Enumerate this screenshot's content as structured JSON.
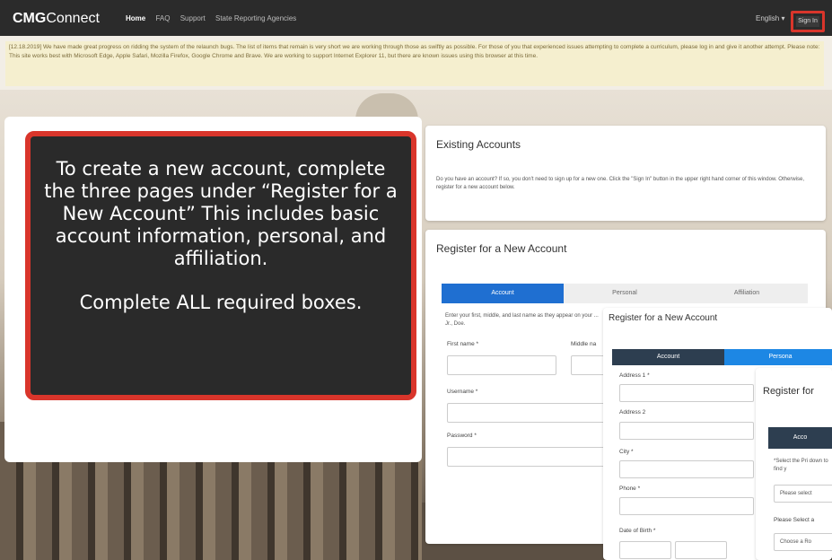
{
  "header": {
    "brand_bold": "CMG",
    "brand_rest": "Connect",
    "nav": [
      "Home",
      "FAQ",
      "Support",
      "State Reporting Agencies"
    ],
    "language": "English ▾",
    "signin_label": "Sign In"
  },
  "notice": {
    "text": "[12.18.2019] We have made great progress on ridding the system of the relaunch bugs. The list of items that remain is very short we are working through those as swiftly as possible. For those of you that experienced issues attempting to complete a curriculum, please log in and give it another attempt. Please note: This site works best with Microsoft Edge, Apple Safari, Mozilla Firefox, Google Chrome and Brave. We are working to support Internet Explorer 11, but there are known issues using this browser at this time."
  },
  "callout": {
    "main": "To create a new account, complete the three pages under “Register for a New Account” This includes basic account information, personal, and affiliation.",
    "sub": "Complete ALL required boxes."
  },
  "existing": {
    "title": "Existing Accounts",
    "text": "Do you have an account? If so, you don't need to sign up for a new one. Click the \"Sign In\" button in the upper right hand corner of this window. Otherwise, register for a new account below."
  },
  "register": {
    "title": "Register for a New Account",
    "tabs": [
      "Account",
      "Personal",
      "Affiliation"
    ],
    "instruction": "Enter your first, middle, and last name as they appear on your ... Jr., Doe.",
    "first_name_label": "First name *",
    "middle_name_label": "Middle na",
    "username_label": "Username *",
    "password_label": "Password *"
  },
  "register2": {
    "title": "Register for a New Account",
    "tabs": [
      "Account",
      "Persona"
    ],
    "address1_label": "Address 1 *",
    "address2_label": "Address 2",
    "city_label": "City *",
    "phone_label": "Phone *",
    "dob_label": "Date of Birth *"
  },
  "register3": {
    "title": "Register for",
    "tab": "Acco",
    "select_text": "*Select the Pri down to find y",
    "select_placeholder": "Please select",
    "select2_label": "Please Select a",
    "role_placeholder": "Choose a Ro"
  }
}
